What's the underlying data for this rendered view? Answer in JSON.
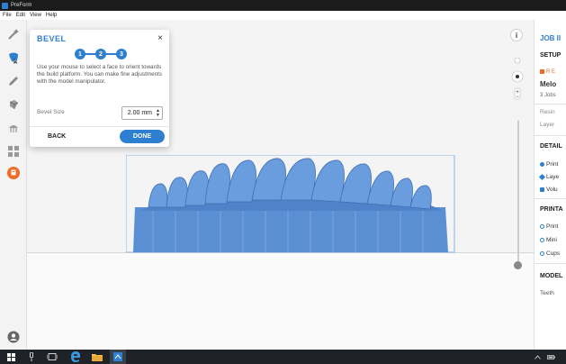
{
  "app": {
    "title": "PreForm"
  },
  "menu": [
    "File",
    "Edit",
    "View",
    "Help"
  ],
  "toolbar": {
    "items": [
      "magic-wand-icon",
      "tooth-select-icon",
      "pen-icon",
      "orient-icon",
      "support-icon",
      "layout-icon",
      "print-icon",
      "account-icon"
    ],
    "accent": "#f06a28"
  },
  "bevel": {
    "title": "BEVEL",
    "close": "×",
    "steps": [
      "1",
      "2",
      "3"
    ],
    "description": "Use your mouse to select a face to orient towards the build platform. You can make fine adjustments with the model manipulator.",
    "size_label": "Bevel Size",
    "size_value": "2.00 mm",
    "back_label": "BACK",
    "done_label": "DONE",
    "accent": "#2f7fd0"
  },
  "viewport": {
    "info": "i",
    "view_labels": [
      "^",
      "◄",
      "►",
      "v"
    ],
    "zoom_in": "+",
    "zoom_out": "−"
  },
  "job_panel": {
    "title": "JOB II",
    "setup": "SETUP",
    "resin_tag": "R E",
    "printer": "Melo",
    "jobs": "3 Jobs",
    "resin": "Resin",
    "layer": "Layer",
    "details": "DETAIL",
    "detail_items": [
      "Print",
      "Laye",
      "Volu"
    ],
    "printability": "PRINTA",
    "printability_items": [
      "Print",
      "Mini",
      "Cups"
    ],
    "model": "MODEL",
    "model_item": "Teeth"
  },
  "colors": {
    "model": "#5b8fd3",
    "selection": "#8ab4e8"
  }
}
